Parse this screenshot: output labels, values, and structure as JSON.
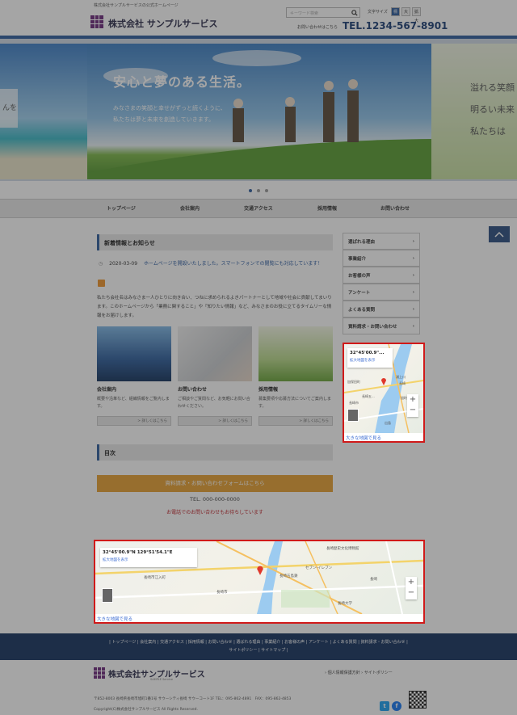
{
  "header": {
    "tagline": "株式会社サンプルサービスの公式ホームページ",
    "company_name": "株式会社 サンプルサービス",
    "search_placeholder": "キーワード検索",
    "font_size_label": "文字サイズ",
    "font_sizes": [
      "標準",
      "大",
      "拡大"
    ],
    "contact_note": "お問い合わせはこちら",
    "tel": "TEL.1234-567-8901"
  },
  "hero": {
    "title": "安心と夢のある生活。",
    "subtitle_line1": "みなさまの笑顔と幸せがずっと続くように、",
    "subtitle_line2": "私たちは夢と未来を創造していきます。",
    "side_line1": "溢れる笑顔",
    "side_line2": "明るい未来",
    "side_line3": "私たちは",
    "left_partial": "んを"
  },
  "nav": {
    "items": [
      "トップページ",
      "会社案内",
      "交通アクセス",
      "採用情報",
      "お問い合わせ"
    ]
  },
  "news": {
    "heading": "新着情報とお知らせ",
    "date": "2020-03-09",
    "text": "ホームページを開設いたしました。スマートフォンでの閲覧にも対応しています！",
    "intro": "私たち会社名はみなさま一人ひとりに向き合い、つねに求められるよきパートナーとして地域や社会に貢献してまいります。このホームページから「業務に関すること」や「知りたい情報」など、みなさまのお役に立てるタイムリーな情報をお届けします。"
  },
  "cards": [
    {
      "title": "会社案内",
      "desc": "概要や沿革など、組織情報をご覧内します。",
      "button": "> 詳しくはこちら"
    },
    {
      "title": "お問い合わせ",
      "desc": "ご相談やご質問など、お気軽にお問い合わせください。",
      "button": "> 詳しくはこちら"
    },
    {
      "title": "採用情報",
      "desc": "募集要項や応募方法についてご案内します。",
      "button": "> 詳しくはこちら"
    }
  ],
  "toc": {
    "heading": "目次"
  },
  "cta": {
    "button": "資料請求・お問い合わせフォームはこちら",
    "tel": "TEL. 000-000-0000",
    "note": "お電話でのお問い合わせもお待ちしています"
  },
  "side_menu": {
    "items": [
      "選ばれる理由",
      "事業紹介",
      "お客様の声",
      "アンケート",
      "よくある質問",
      "資料請求・お問い合わせ"
    ]
  },
  "map_small": {
    "coord": "32°45'00.9\"...",
    "enlarge": "拡大地図を表示",
    "big_link": "大きな地図で見る",
    "labels": [
      "浦上川",
      "長崎",
      "加保田町",
      "長崎五...",
      "長崎市",
      "旭町",
      "出島"
    ]
  },
  "map_large": {
    "coord": "32°45'00.9\"N 129°51'54.1\"E",
    "enlarge": "拡大地図を表示",
    "big_link": "大きな地図で見る",
    "labels": [
      "長崎歴史文化博物館",
      "長崎市江入町",
      "長崎五島鉄",
      "長崎市",
      "セブン-イレブン",
      "長崎",
      "長崎大学"
    ]
  },
  "footer": {
    "nav": "| トップページ | 会社案内 | 交通アクセス | 採用情報 | お問い合わせ | 選ばれる理由 | 事業紹介 | お客様の声 | アンケート | よくある質問 | 資料請求・お問い合わせ |",
    "nav2": "サイトポリシー | サイトマップ |",
    "company_name": "株式会社サンプルサービス",
    "company_sub": "SAMPLE Service",
    "links": "› 個人情報保護方針  › サイトポリシー",
    "address": "〒852-8003 長崎県長崎市旭町1番1号 サウーシティ長崎 サウーコート1F TEL：095-862-4891　FAX：095-862-4853",
    "copyright": "Copyright(C)株式会社サンプルサービス All Rights Reserved."
  },
  "colors": {
    "accent": "#2f5e9e",
    "highlight": "#d01a1a",
    "cta": "#e7a133",
    "footer": "#15325f"
  }
}
